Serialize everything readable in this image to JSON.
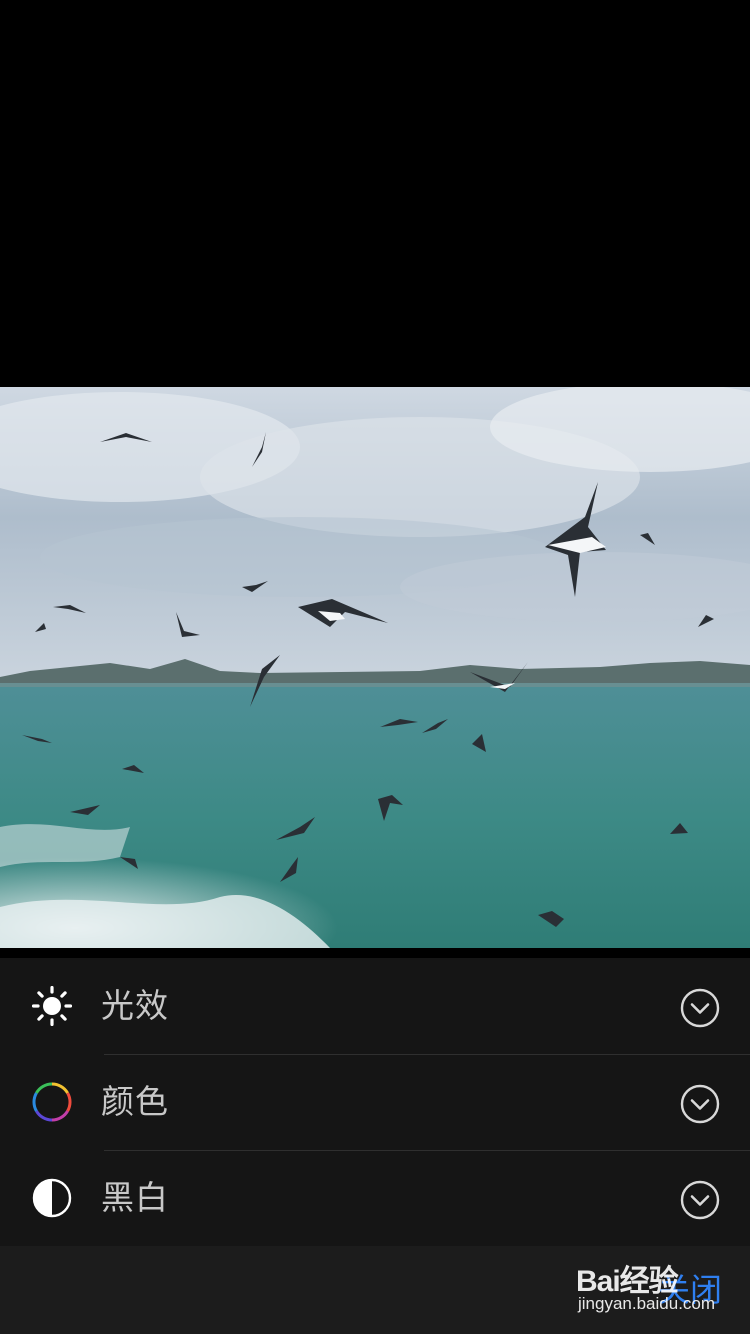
{
  "photo": {
    "description_icon": "seagulls-over-sea-photo"
  },
  "adjustments": {
    "items": [
      {
        "label": "光效",
        "icon": "sun-icon"
      },
      {
        "label": "颜色",
        "icon": "color-wheel-icon"
      },
      {
        "label": "黑白",
        "icon": "half-circle-icon"
      }
    ]
  },
  "toolbar": {
    "close_label": "关闭"
  },
  "watermark": {
    "brand": "Bai经验",
    "url": "jingyan.baidu.com"
  },
  "colors": {
    "panel_bg": "#151515",
    "label": "#c8c8c8",
    "accent": "#2f7ff0"
  }
}
